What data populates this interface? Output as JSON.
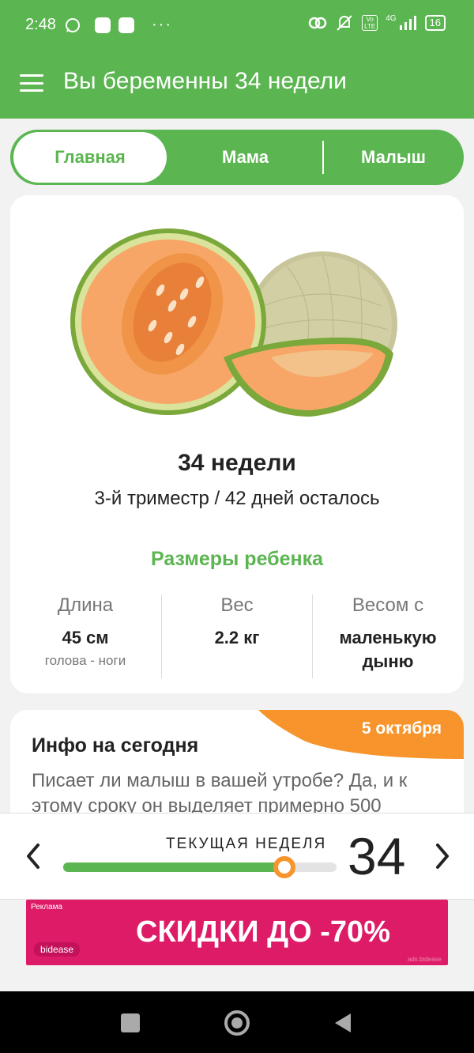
{
  "status_bar": {
    "time": "2:48",
    "network": "4G",
    "volte": "Vo LTE",
    "battery": "16",
    "more": "···"
  },
  "app_bar": {
    "title": "Вы беременны 34 недели"
  },
  "tabs": [
    {
      "label": "Главная",
      "active": true
    },
    {
      "label": "Мама",
      "active": false
    },
    {
      "label": "Малыш",
      "active": false
    }
  ],
  "week_card": {
    "image_subject": "cantaloupe melon",
    "title": "34 недели",
    "subtitle": "3-й триместр / 42 дней осталось",
    "sizes_title": "Размеры ребенка",
    "stats": [
      {
        "label": "Длина",
        "value": "45 см",
        "note": "голова - ноги"
      },
      {
        "label": "Вес",
        "value": "2.2 кг",
        "note": ""
      },
      {
        "label": "Весом с",
        "value": "маленькую дыню",
        "note": ""
      }
    ]
  },
  "info_card": {
    "date": "5 октября",
    "title": "Инфо на сегодня",
    "text": "Писает ли малыш в вашей утробе? Да, и к этому сроку он выделяет примерно 500"
  },
  "week_nav": {
    "label": "ТЕКУЩАЯ НЕДЕЛЯ",
    "week": "34",
    "progress_fraction": 0.81
  },
  "ad": {
    "tag": "Реклама",
    "brand": "bidease",
    "text": "СКИДКИ ДО -70%",
    "footer": "ads.bidease"
  },
  "colors": {
    "primary_green": "#5bb550",
    "accent_orange": "#f7952c",
    "ad_pink": "#dd1b66"
  }
}
